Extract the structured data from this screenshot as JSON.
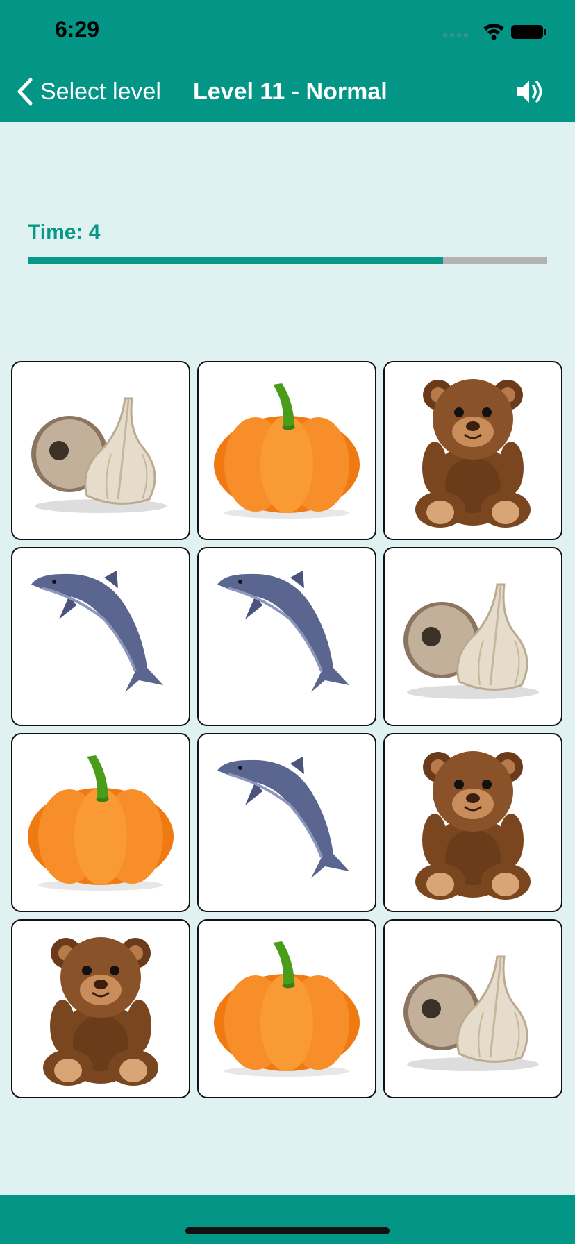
{
  "status": {
    "time": "6:29"
  },
  "nav": {
    "back_label": "Select level",
    "title": "Level 11 - Normal"
  },
  "timer": {
    "label": "Time: 4",
    "progress": 0.8
  },
  "board": {
    "cards": [
      {
        "item": "garlic"
      },
      {
        "item": "pumpkin"
      },
      {
        "item": "teddy-bear"
      },
      {
        "item": "dolphin"
      },
      {
        "item": "dolphin"
      },
      {
        "item": "garlic"
      },
      {
        "item": "pumpkin"
      },
      {
        "item": "dolphin"
      },
      {
        "item": "teddy-bear"
      },
      {
        "item": "teddy-bear"
      },
      {
        "item": "pumpkin"
      },
      {
        "item": "garlic"
      }
    ]
  },
  "colors": {
    "header": "#039586",
    "background": "#dff1f0",
    "accent": "#089888",
    "progress_track": "#b3b3b3"
  }
}
